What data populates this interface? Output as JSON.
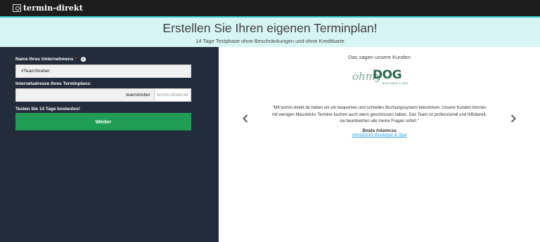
{
  "brand": {
    "name": "termin-direkt",
    "logo_icon": "camera-logo-icon"
  },
  "hero": {
    "title": "Erstellen Sie Ihren eigenen Terminplan!",
    "subtitle": "14 Tage Testphase ohne Beschränkungen und ohne Kreditkarte"
  },
  "form": {
    "company_label": "Name Ihres Unternehmens",
    "required_mark": "*",
    "company_value": "#TeamStreber",
    "url_label": "Internetadresse Ihres Terminplans:",
    "url_slug": "teamstreber",
    "url_domain": "termin-direkt.de",
    "trial_label": "Testen Sie 14 Tage kostenlos!",
    "submit_label": "Weiter"
  },
  "testimonial": {
    "heading": "Das sagen unsere Kunden",
    "logo_text_main": "ohmy",
    "logo_text_dog": "DOG",
    "logo_tagline": "BOUTIQUE & SPA",
    "quote": "\"Mit termin-direkt.de haben wir ein bequemes und schnelles Buchungssystem bekommen. Unsere Kunden können mit wenigen Mausklicks Termine buchen auch wenn geschlossen haben. Das Team ist professionell und hilfsbereit, sie beantworten alle meine Fragen sofort.\"",
    "author": "Beáta Adamcsa",
    "company_link": "ohmyDOG Boutique & Spa"
  },
  "colors": {
    "topbar": "#1d1d1d",
    "accent_line": "#2ec4c4",
    "hero_bg": "#d8f5f6",
    "panel_bg": "#222c3b",
    "button": "#1f9d55",
    "link": "#2aa6dd"
  }
}
